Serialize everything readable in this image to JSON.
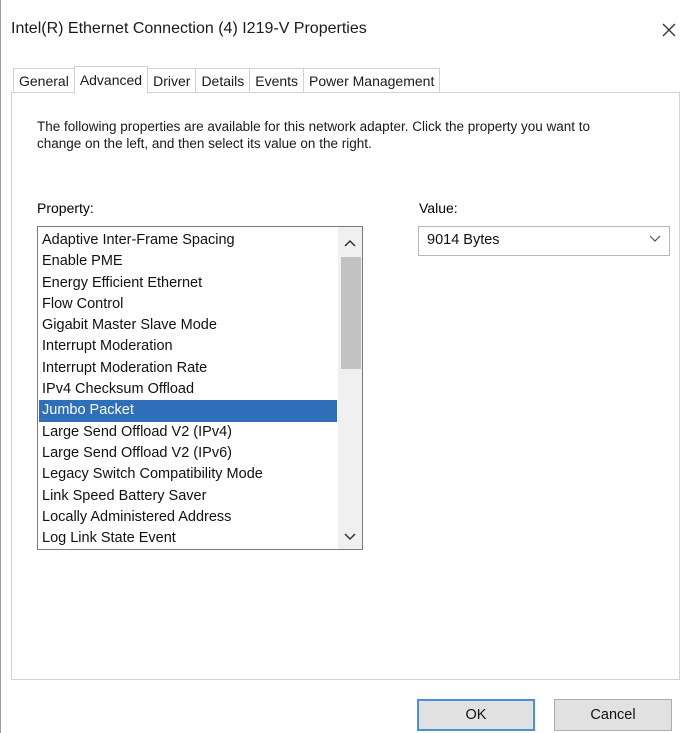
{
  "window": {
    "title": "Intel(R) Ethernet Connection (4) I219-V Properties",
    "close_icon": "close-icon"
  },
  "tabs": [
    {
      "label": "General",
      "active": false
    },
    {
      "label": "Advanced",
      "active": true
    },
    {
      "label": "Driver",
      "active": false
    },
    {
      "label": "Details",
      "active": false
    },
    {
      "label": "Events",
      "active": false
    },
    {
      "label": "Power Management",
      "active": false
    }
  ],
  "advanced": {
    "description": "The following properties are available for this network adapter. Click the property you want to change on the left, and then select its value on the right.",
    "property_label": "Property:",
    "value_label": "Value:",
    "properties": [
      "Adaptive Inter-Frame Spacing",
      "Enable PME",
      "Energy Efficient Ethernet",
      "Flow Control",
      "Gigabit Master Slave Mode",
      "Interrupt Moderation",
      "Interrupt Moderation Rate",
      "IPv4 Checksum Offload",
      "Jumbo Packet",
      "Large Send Offload V2 (IPv4)",
      "Large Send Offload V2 (IPv6)",
      "Legacy Switch Compatibility Mode",
      "Link Speed Battery Saver",
      "Locally Administered Address",
      "Log Link State Event"
    ],
    "selected_property": "Jumbo Packet",
    "value": "9014 Bytes"
  },
  "buttons": {
    "ok": "OK",
    "cancel": "Cancel"
  },
  "colors": {
    "selection": "#2f6fba",
    "ok_focus_border": "#4a90d9"
  }
}
